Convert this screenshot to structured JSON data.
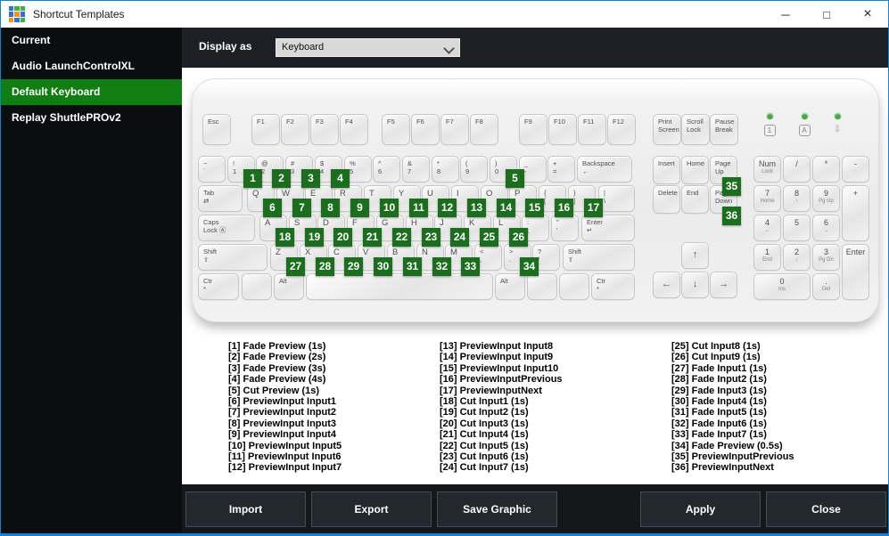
{
  "window": {
    "title": "Shortcut Templates",
    "icon_colors": [
      "#2e73c8",
      "#3fae49",
      "#3fae49",
      "#2e73c8",
      "#f0941f",
      "#2e73c8",
      "#f0941f",
      "#2e73c8",
      "#3fae49"
    ],
    "controls": [
      {
        "name": "minimize",
        "glyph": "─"
      },
      {
        "name": "maximize",
        "glyph": "□"
      },
      {
        "name": "close",
        "glyph": "×"
      }
    ]
  },
  "sidebar": {
    "items": [
      {
        "label": "Current",
        "selected": false
      },
      {
        "label": "Audio LaunchControlXL",
        "selected": false
      },
      {
        "label": "Default Keyboard",
        "selected": true
      },
      {
        "label": "Replay ShuttlePROv2",
        "selected": false
      }
    ]
  },
  "topbar": {
    "label": "Display as",
    "dropdown_value": "Keyboard"
  },
  "keyboard": {
    "function_row": [
      {
        "id": "esc",
        "lines": [
          "Esc"
        ]
      },
      {
        "id": "f1",
        "lines": [
          "F1"
        ]
      },
      {
        "id": "f2",
        "lines": [
          "F2"
        ]
      },
      {
        "id": "f3",
        "lines": [
          "F3"
        ]
      },
      {
        "id": "f4",
        "lines": [
          "F4"
        ]
      },
      {
        "id": "f5",
        "lines": [
          "F5"
        ]
      },
      {
        "id": "f6",
        "lines": [
          "F6"
        ]
      },
      {
        "id": "f7",
        "lines": [
          "F7"
        ]
      },
      {
        "id": "f8",
        "lines": [
          "F8"
        ]
      },
      {
        "id": "f9",
        "lines": [
          "F9"
        ]
      },
      {
        "id": "f10",
        "lines": [
          "F10"
        ]
      },
      {
        "id": "f11",
        "lines": [
          "F11"
        ]
      },
      {
        "id": "f12",
        "lines": [
          "F12"
        ]
      },
      {
        "id": "print-screen",
        "lines": [
          "Print",
          "Screen"
        ]
      },
      {
        "id": "scroll-lock",
        "lines": [
          "Scroll",
          "Lock"
        ]
      },
      {
        "id": "pause-break",
        "lines": [
          "Pause",
          "Break"
        ]
      }
    ],
    "leds": [
      {
        "name": "num-lock-led",
        "glyph": "1",
        "boxed": true
      },
      {
        "name": "caps-lock-led",
        "glyph": "A",
        "boxed": true
      },
      {
        "name": "scroll-lock-led",
        "glyph": "⇩",
        "boxed": false
      }
    ],
    "rows": [
      [
        {
          "id": "backtick",
          "lines": [
            "~",
            "`"
          ]
        },
        {
          "id": "1",
          "lines": [
            "!",
            "1"
          ],
          "badge": 1
        },
        {
          "id": "2",
          "lines": [
            "@",
            "2"
          ],
          "badge": 2
        },
        {
          "id": "3",
          "lines": [
            "#",
            "3"
          ],
          "badge": 3
        },
        {
          "id": "4",
          "lines": [
            "$",
            "4"
          ],
          "badge": 4
        },
        {
          "id": "5",
          "lines": [
            "%",
            "5"
          ]
        },
        {
          "id": "6",
          "lines": [
            "^",
            "6"
          ]
        },
        {
          "id": "7",
          "lines": [
            "&",
            "7"
          ]
        },
        {
          "id": "8",
          "lines": [
            "*",
            "8"
          ]
        },
        {
          "id": "9",
          "lines": [
            "(",
            "9"
          ]
        },
        {
          "id": "0",
          "lines": [
            ")",
            "0"
          ],
          "badge": 5
        },
        {
          "id": "minus",
          "lines": [
            "_",
            "-"
          ]
        },
        {
          "id": "equals",
          "lines": [
            "+",
            "="
          ]
        },
        {
          "id": "backspace",
          "lines": [
            "Backspace",
            "←"
          ]
        }
      ],
      [
        {
          "id": "tab",
          "lines": [
            "Tab",
            "⇄"
          ]
        },
        {
          "id": "q",
          "lines": [
            "Q"
          ],
          "badge": 6
        },
        {
          "id": "w",
          "lines": [
            "W"
          ],
          "badge": 7
        },
        {
          "id": "e",
          "lines": [
            "E"
          ],
          "badge": 8
        },
        {
          "id": "r",
          "lines": [
            "R"
          ],
          "badge": 9
        },
        {
          "id": "t",
          "lines": [
            "T"
          ],
          "badge": 10
        },
        {
          "id": "y",
          "lines": [
            "Y"
          ],
          "badge": 11
        },
        {
          "id": "u",
          "lines": [
            "U"
          ],
          "badge": 12
        },
        {
          "id": "i",
          "lines": [
            "I"
          ],
          "badge": 13
        },
        {
          "id": "o",
          "lines": [
            "O"
          ],
          "badge": 14
        },
        {
          "id": "p",
          "lines": [
            "P"
          ],
          "badge": 15
        },
        {
          "id": "bracket-left",
          "lines": [
            "{",
            "["
          ],
          "badge": 16
        },
        {
          "id": "bracket-right",
          "lines": [
            "}",
            "]"
          ],
          "badge": 17
        },
        {
          "id": "backslash",
          "lines": [
            "|",
            "\\"
          ]
        }
      ],
      [
        {
          "id": "caps-lock",
          "lines": [
            "Caps",
            "Lock Ⓐ"
          ]
        },
        {
          "id": "a",
          "lines": [
            "A"
          ],
          "badge": 18
        },
        {
          "id": "s",
          "lines": [
            "S"
          ],
          "badge": 19
        },
        {
          "id": "d",
          "lines": [
            "D"
          ],
          "badge": 20
        },
        {
          "id": "f",
          "lines": [
            "F"
          ],
          "badge": 21
        },
        {
          "id": "g",
          "lines": [
            "G"
          ],
          "badge": 22
        },
        {
          "id": "h",
          "lines": [
            "H"
          ],
          "badge": 23
        },
        {
          "id": "j",
          "lines": [
            "J"
          ],
          "badge": 24
        },
        {
          "id": "k",
          "lines": [
            "K"
          ],
          "badge": 25
        },
        {
          "id": "l",
          "lines": [
            "L"
          ],
          "badge": 26
        },
        {
          "id": "semicolon",
          "lines": [
            ":",
            ";"
          ]
        },
        {
          "id": "quote",
          "lines": [
            "\"",
            "'"
          ]
        },
        {
          "id": "enter",
          "lines": [
            "Enter",
            "↵"
          ]
        }
      ],
      [
        {
          "id": "shift-left",
          "lines": [
            "Shift",
            "⇧"
          ]
        },
        {
          "id": "z",
          "lines": [
            "Z"
          ],
          "badge": 27
        },
        {
          "id": "x",
          "lines": [
            "X"
          ],
          "badge": 28
        },
        {
          "id": "c",
          "lines": [
            "C"
          ],
          "badge": 29
        },
        {
          "id": "v",
          "lines": [
            "V"
          ],
          "badge": 30
        },
        {
          "id": "b",
          "lines": [
            "B"
          ],
          "badge": 31
        },
        {
          "id": "n",
          "lines": [
            "N"
          ],
          "badge": 32
        },
        {
          "id": "m",
          "lines": [
            "M"
          ],
          "badge": 33
        },
        {
          "id": "comma",
          "lines": [
            "<",
            ","
          ]
        },
        {
          "id": "period",
          "lines": [
            ">",
            "."
          ],
          "badge": 34
        },
        {
          "id": "slash",
          "lines": [
            "?",
            "/"
          ]
        },
        {
          "id": "shift-right",
          "lines": [
            "Shift",
            "⇧"
          ]
        }
      ],
      [
        {
          "id": "ctrl-left",
          "lines": [
            "Ctr",
            "*"
          ]
        },
        {
          "id": "win-left",
          "lines": []
        },
        {
          "id": "alt-left",
          "lines": [
            "Alt"
          ]
        },
        {
          "id": "space",
          "lines": []
        },
        {
          "id": "alt-right",
          "lines": [
            "Alt"
          ]
        },
        {
          "id": "win-right",
          "lines": []
        },
        {
          "id": "menu",
          "lines": []
        },
        {
          "id": "ctrl-right",
          "lines": [
            "Ctr",
            "*"
          ]
        }
      ]
    ],
    "nav": [
      {
        "id": "insert",
        "lines": [
          "Insert"
        ]
      },
      {
        "id": "home",
        "lines": [
          "Home"
        ]
      },
      {
        "id": "page-up",
        "lines": [
          "Page",
          "Up"
        ],
        "badge": 35
      },
      {
        "id": "delete",
        "lines": [
          "Delete"
        ]
      },
      {
        "id": "end",
        "lines": [
          "End"
        ]
      },
      {
        "id": "page-down",
        "lines": [
          "Page",
          "Down"
        ],
        "badge": 36
      }
    ],
    "arrows": [
      {
        "id": "arrow-up",
        "lines": [
          "↑"
        ]
      },
      {
        "id": "arrow-left",
        "lines": [
          "←"
        ]
      },
      {
        "id": "arrow-down",
        "lines": [
          "↓"
        ]
      },
      {
        "id": "arrow-right",
        "lines": [
          "→"
        ]
      }
    ],
    "numpad": [
      {
        "id": "num-lock",
        "lines": [
          "Num",
          "Lock"
        ]
      },
      {
        "id": "np-divide",
        "lines": [
          "/"
        ]
      },
      {
        "id": "np-multiply",
        "lines": [
          "*"
        ]
      },
      {
        "id": "np-minus",
        "lines": [
          "-"
        ]
      },
      {
        "id": "np-7",
        "lines": [
          "7",
          "Home"
        ]
      },
      {
        "id": "np-8",
        "lines": [
          "8",
          "↑"
        ]
      },
      {
        "id": "np-9",
        "lines": [
          "9",
          "Pg Up"
        ]
      },
      {
        "id": "np-plus",
        "lines": [
          "+"
        ]
      },
      {
        "id": "np-4",
        "lines": [
          "4",
          "←"
        ]
      },
      {
        "id": "np-5",
        "lines": [
          "5"
        ]
      },
      {
        "id": "np-6",
        "lines": [
          "6",
          "→"
        ]
      },
      {
        "id": "np-1",
        "lines": [
          "1",
          "End"
        ]
      },
      {
        "id": "np-2",
        "lines": [
          "2",
          "↓"
        ]
      },
      {
        "id": "np-3",
        "lines": [
          "3",
          "Pg Dn"
        ]
      },
      {
        "id": "np-enter",
        "lines": [
          "Enter"
        ]
      },
      {
        "id": "np-0",
        "lines": [
          "0",
          "Ins"
        ]
      },
      {
        "id": "np-period",
        "lines": [
          ".",
          "Del"
        ]
      }
    ]
  },
  "legend": {
    "columns": [
      [
        "[1] Fade Preview (1s)",
        "[2] Fade Preview (2s)",
        "[3] Fade Preview (3s)",
        "[4] Fade Preview (4s)",
        "[5] Cut Preview (1s)",
        "[6] PreviewInput Input1",
        "[7] PreviewInput Input2",
        "[8] PreviewInput Input3",
        "[9] PreviewInput Input4",
        "[10] PreviewInput Input5",
        "[11] PreviewInput Input6",
        "[12] PreviewInput Input7"
      ],
      [
        "[13] PreviewInput Input8",
        "[14] PreviewInput Input9",
        "[15] PreviewInput Input10",
        "[16] PreviewInputPrevious",
        "[17] PreviewInputNext",
        "[18] Cut Input1 (1s)",
        "[19] Cut Input2 (1s)",
        "[20] Cut Input3 (1s)",
        "[21] Cut Input4 (1s)",
        "[22] Cut Input5 (1s)",
        "[23] Cut Input6 (1s)",
        "[24] Cut Input7 (1s)"
      ],
      [
        "[25] Cut Input8 (1s)",
        "[26] Cut Input9 (1s)",
        "[27] Fade Input1 (1s)",
        "[28] Fade Input2 (1s)",
        "[29] Fade Input3 (1s)",
        "[30] Fade Input4 (1s)",
        "[31] Fade Input5 (1s)",
        "[32] Fade Input6 (1s)",
        "[33] Fade Input7 (1s)",
        "[34] Fade Preview (0.5s)",
        "[35] PreviewInputPrevious",
        "[36] PreviewInputNext"
      ]
    ]
  },
  "footer": {
    "buttons": [
      {
        "label": "Import"
      },
      {
        "label": "Export"
      },
      {
        "label": "Save Graphic"
      },
      {
        "label": "Apply"
      },
      {
        "label": "Close"
      }
    ]
  },
  "colors": {
    "window_border": "#1182d6",
    "sidebar_bg": "#0b0e11",
    "selected_green": "#117e13",
    "badge_green": "#1a6e1e",
    "topbar_bg": "#1d2125",
    "footer_bg": "#14181b"
  }
}
